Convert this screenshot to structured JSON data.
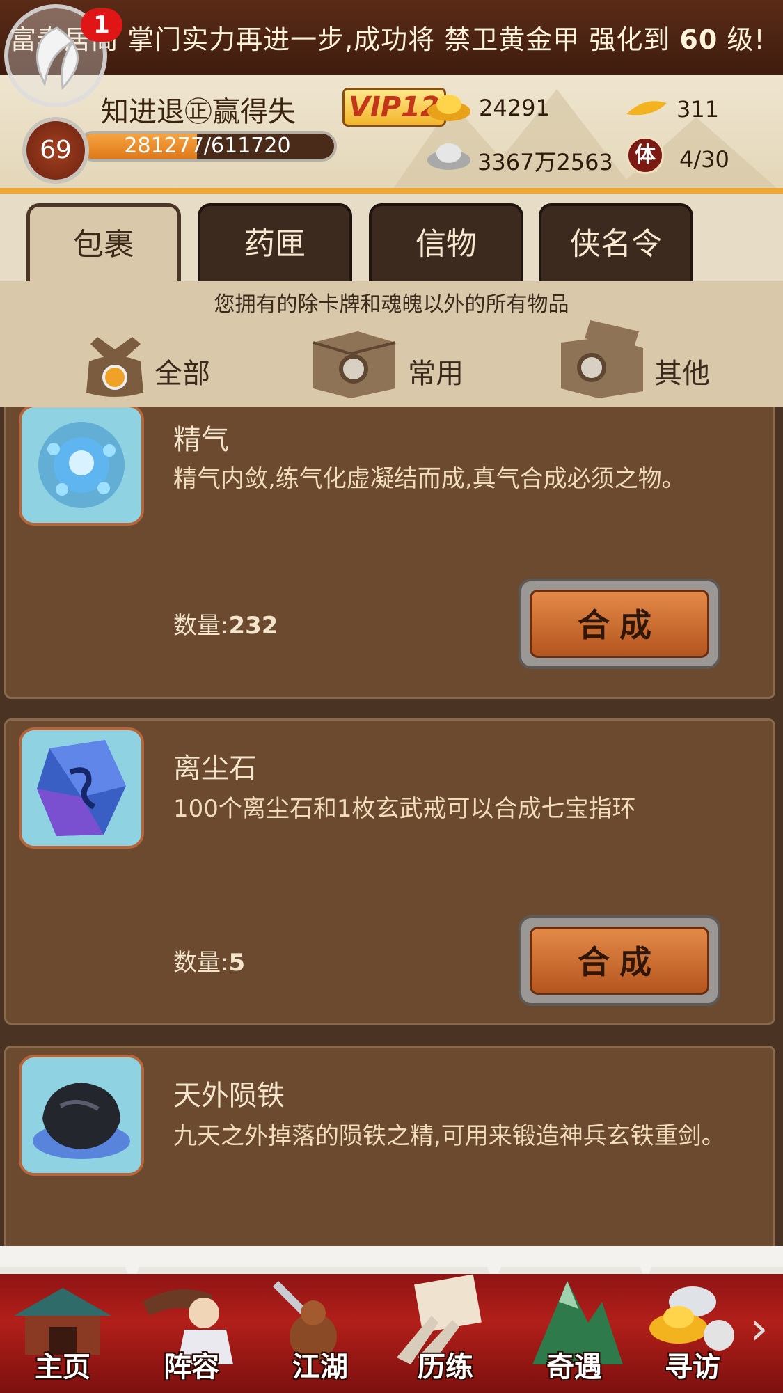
{
  "announcement": {
    "prefix": "富春居阁",
    "middle": " 掌门实力再进一步,成功将 禁卫黄金甲 强化到 ",
    "level": "60",
    "suffix": " 级!"
  },
  "notification_count": "1",
  "player": {
    "name": "知进退㊣赢得失",
    "vip": "VIP12",
    "level": "69",
    "exp_text": "281277/611720",
    "exp_fraction": 0.46
  },
  "resources": {
    "gold": "24291",
    "gold_leaf": "311",
    "silver": "3367万2563",
    "stamina_icon_text": "体",
    "stamina": "4/30"
  },
  "tabs": [
    {
      "label": "包裹",
      "active": true
    },
    {
      "label": "药匣",
      "active": false
    },
    {
      "label": "信物",
      "active": false
    },
    {
      "label": "侠名令",
      "active": false
    }
  ],
  "hint": "您拥有的除卡牌和魂魄以外的所有物品",
  "filters": [
    {
      "label": "全部"
    },
    {
      "label": "常用"
    },
    {
      "label": "其他"
    }
  ],
  "items": [
    {
      "name": "精气",
      "desc": "精气内敛,练气化虚凝结而成,真气合成必须之物。",
      "qty_label": "数量:",
      "qty": "232",
      "button": "合成"
    },
    {
      "name": "离尘石",
      "desc": "100个离尘石和1枚玄武戒可以合成七宝指环",
      "qty_label": "数量:",
      "qty": "5",
      "button": "合成"
    },
    {
      "name": "天外陨铁",
      "desc": "九天之外掉落的陨铁之精,可用来锻造神兵玄铁重剑。"
    }
  ],
  "nav": [
    {
      "label": "主页"
    },
    {
      "label": "阵容"
    },
    {
      "label": "江湖"
    },
    {
      "label": "历练"
    },
    {
      "label": "奇遇"
    },
    {
      "label": "寻访"
    }
  ],
  "nav_more": "›",
  "colors": {
    "accent_orange": "#f0a631",
    "button_orange": "#d9793a",
    "nav_red": "#b21f1a",
    "panel_brown": "#6b4a30"
  }
}
